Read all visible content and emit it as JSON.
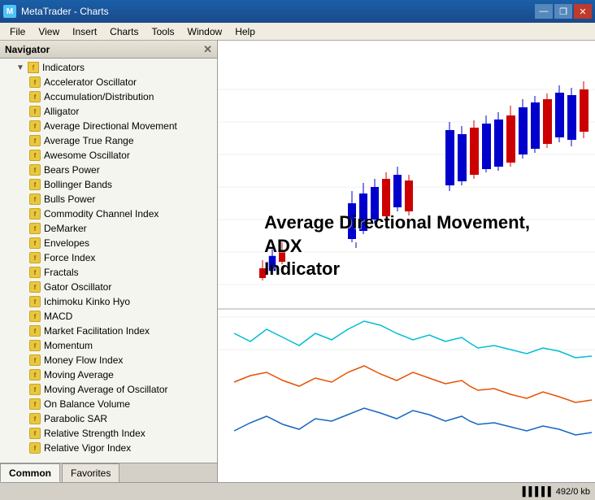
{
  "window": {
    "title": "MetaTrader - Charts",
    "title_controls": {
      "minimize": "—",
      "maximize": "❐",
      "close": "✕"
    }
  },
  "menu": {
    "items": [
      "File",
      "View",
      "Insert",
      "Charts",
      "Tools",
      "Window",
      "Help"
    ]
  },
  "navigator": {
    "title": "Navigator",
    "close_btn": "✕",
    "root": {
      "label": "Indicators",
      "items": [
        "Accelerator Oscillator",
        "Accumulation/Distribution",
        "Alligator",
        "Average Directional Movement",
        "Average True Range",
        "Awesome Oscillator",
        "Bears Power",
        "Bollinger Bands",
        "Bulls Power",
        "Commodity Channel Index",
        "DeMarker",
        "Envelopes",
        "Force Index",
        "Fractals",
        "Gator Oscillator",
        "Ichimoku Kinko Hyo",
        "MACD",
        "Market Facilitation Index",
        "Momentum",
        "Money Flow Index",
        "Moving Average",
        "Moving Average of Oscillator",
        "On Balance Volume",
        "Parabolic SAR",
        "Relative Strength Index",
        "Relative Vigor Index"
      ]
    },
    "tabs": [
      "Common",
      "Favorites"
    ]
  },
  "chart": {
    "adx_label_line1": "Average Directional Movement,",
    "adx_label_line2": "ADX",
    "adx_label_line3": "Indicator"
  },
  "status_bar": {
    "info": "492/0 kb"
  }
}
